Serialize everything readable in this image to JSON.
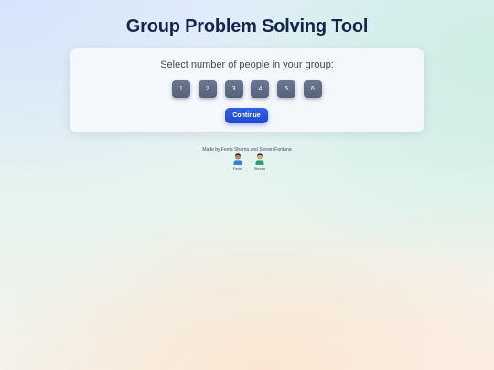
{
  "page": {
    "title": "Group Problem Solving Tool"
  },
  "card": {
    "prompt": "Select number of people in your group:",
    "options": [
      "1",
      "2",
      "3",
      "4",
      "5",
      "6"
    ],
    "continue_label": "Continue"
  },
  "credits": {
    "text": "Made by Ferris Sharna and Steven Fontana",
    "people": [
      {
        "name": "Ferris",
        "shirt_color": "#3a7bd5",
        "hair_color": "#2b2118",
        "skin_color": "#b9855a"
      },
      {
        "name": "Steven",
        "shirt_color": "#2f9e6e",
        "hair_color": "#3b2a1c",
        "skin_color": "#d9a77c"
      }
    ]
  },
  "colors": {
    "title": "#16264a",
    "number_button": "#5f6b83",
    "continue_button": "#2453dc"
  }
}
